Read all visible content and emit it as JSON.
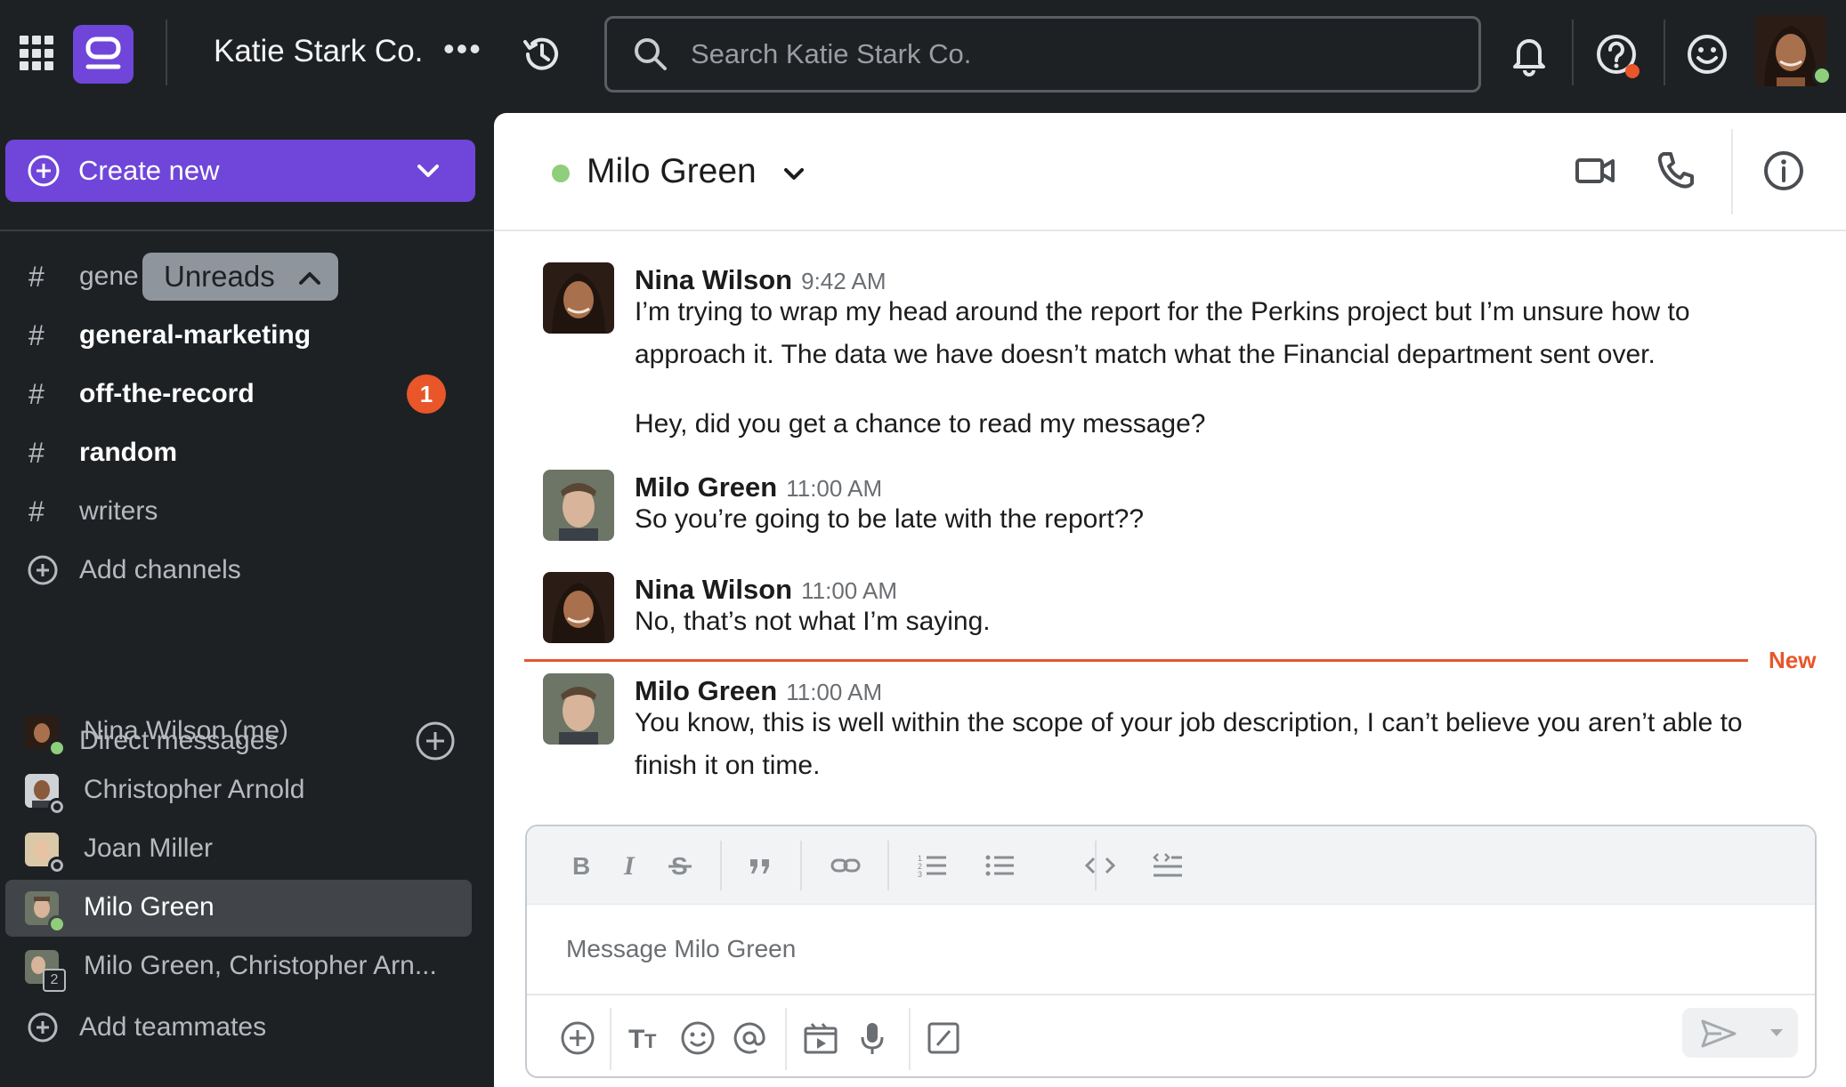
{
  "workspace": {
    "name": "Katie Stark Co.",
    "more": "•••"
  },
  "search": {
    "placeholder": "Search Katie Stark Co."
  },
  "sidebar": {
    "create_label": "Create new",
    "unreads_label": "Unreads",
    "channels": [
      {
        "name": "gene",
        "unread": false
      },
      {
        "name": "general-marketing",
        "unread": true
      },
      {
        "name": "off-the-record",
        "unread": true,
        "badge": "1"
      },
      {
        "name": "random",
        "unread": true
      },
      {
        "name": "writers",
        "unread": false
      }
    ],
    "add_channels": "Add channels",
    "dm_header": "Direct messages",
    "dms": [
      {
        "name": "Nina Wilson (me)",
        "status": "online"
      },
      {
        "name": "Christopher Arnold",
        "status": "offline"
      },
      {
        "name": "Joan Miller",
        "status": "offline"
      },
      {
        "name": "Milo Green",
        "status": "online",
        "active": true
      },
      {
        "name": "Milo Green, Christopher Arn...",
        "status": "group",
        "count": "2"
      }
    ],
    "add_teammates": "Add teammates"
  },
  "channel": {
    "title": "Milo Green"
  },
  "messages": [
    {
      "author": "Nina Wilson",
      "time": "9:42 AM",
      "text": "I’m trying to wrap my head around the report for the Perkins project but I’m unsure how to approach it. The data we have doesn’t match what the Financial department sent over."
    },
    {
      "author": "",
      "time": "",
      "text": "Hey, did you get a chance to read my message?"
    },
    {
      "author": "Milo Green",
      "time": "11:00 AM",
      "text": "So you’re going to be late with the report??"
    },
    {
      "author": "Nina Wilson",
      "time": "11:00 AM",
      "text": "No, that’s not what I’m saying."
    },
    {
      "author": "Milo Green",
      "time": "11:00 AM",
      "text": "You know, this is well within the scope of your job description, I can’t believe you aren’t able to finish it on time."
    }
  ],
  "new_marker": "New",
  "composer": {
    "placeholder": "Message Milo Green"
  },
  "colors": {
    "accent": "#6f46d9",
    "online": "#8fce7b",
    "alert": "#e8562a",
    "sidebar_bg": "#1e2124"
  }
}
